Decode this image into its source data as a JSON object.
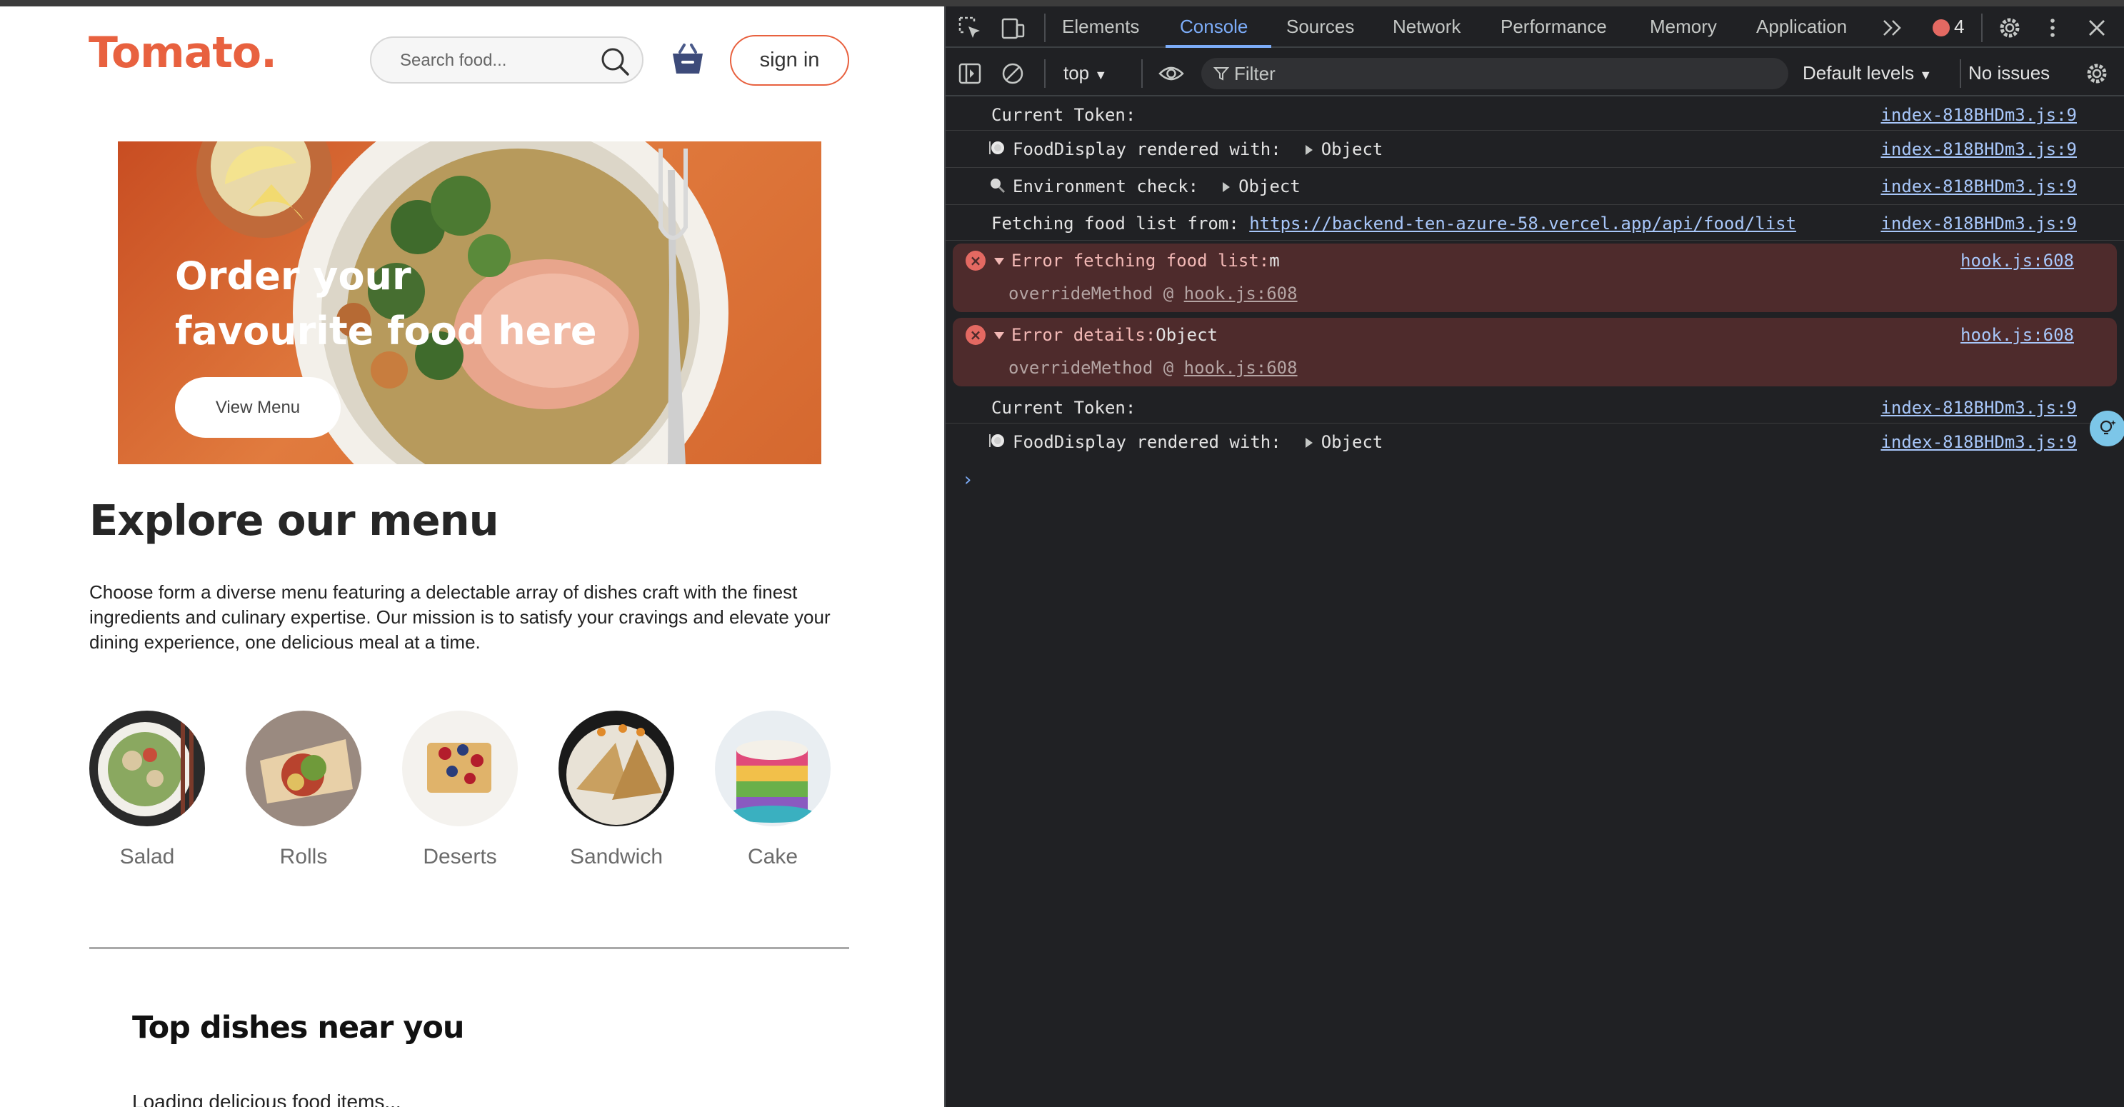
{
  "page": {
    "logo": "Tomato.",
    "search_placeholder": "Search food...",
    "signin_label": "sign in",
    "hero": {
      "title": "Order your favourite food here",
      "button_label": "View Menu"
    },
    "explore": {
      "title": "Explore our menu",
      "text": "Choose form a diverse menu featuring a delectable array of dishes craft with the finest ingredients and culinary expertise. Our mission is to satisfy your cravings and elevate your dining experience, one delicious meal at a time."
    },
    "menu_items": [
      {
        "label": "Salad"
      },
      {
        "label": "Rolls"
      },
      {
        "label": "Deserts"
      },
      {
        "label": "Sandwich"
      },
      {
        "label": "Cake"
      }
    ],
    "top_dishes_title": "Top dishes near you",
    "loading_text": "Loading delicious food items..."
  },
  "devtools": {
    "tabs": [
      "Elements",
      "Console",
      "Sources",
      "Network",
      "Performance",
      "Memory",
      "Application"
    ],
    "active_tab": "Console",
    "error_count": "4",
    "context": "top",
    "filter_placeholder": "Filter",
    "levels": "Default levels",
    "issues": "No issues",
    "accent_color": "#7cacf8",
    "error_bg_color": "#4e2b2c",
    "logs": [
      {
        "type": "log",
        "text": "Current Token:",
        "source": "index-818BHDm3.js:9"
      },
      {
        "type": "log",
        "icon": "plate-icon",
        "text": "FoodDisplay rendered with:",
        "value": "Object",
        "source": "index-818BHDm3.js:9"
      },
      {
        "type": "log",
        "icon": "magnifier-icon",
        "text": "Environment check:",
        "value": "Object",
        "source": "index-818BHDm3.js:9"
      },
      {
        "type": "log",
        "text": "Fetching food list from:",
        "link": "https://backend-ten-azure-58.vercel.app/api/food/list",
        "source": "index-818BHDm3.js:9"
      },
      {
        "type": "error",
        "text": "Error fetching food list:",
        "value": "m",
        "stack_fn": "overrideMethod @",
        "stack_link": "hook.js:608",
        "source": "hook.js:608"
      },
      {
        "type": "error",
        "text": "Error details:",
        "value": "Object",
        "stack_fn": "overrideMethod @",
        "stack_link": "hook.js:608",
        "source": "hook.js:608"
      },
      {
        "type": "log",
        "text": "Current Token:",
        "source": "index-818BHDm3.js:9"
      },
      {
        "type": "log",
        "icon": "plate-icon",
        "text": "FoodDisplay rendered with:",
        "value": "Object",
        "source": "index-818BHDm3.js:9"
      }
    ],
    "prompt": "›"
  },
  "colors": {
    "brand": "#e8613f"
  }
}
